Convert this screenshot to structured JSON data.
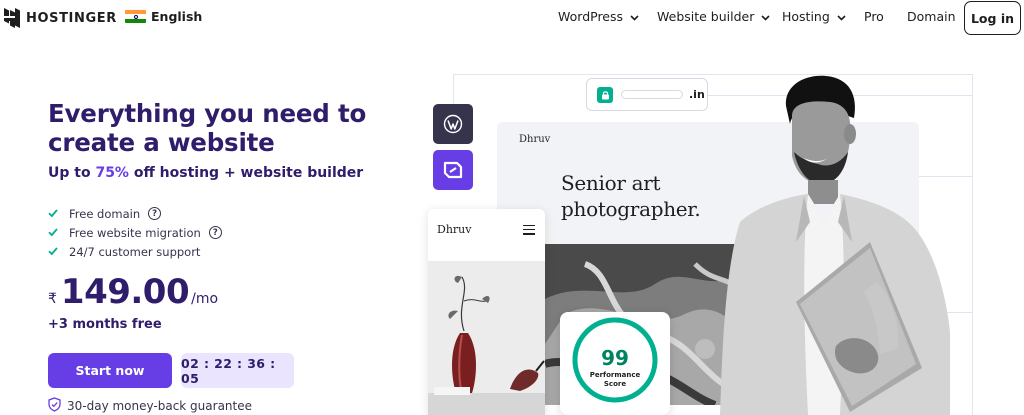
{
  "header": {
    "brand": "HOSTINGER",
    "language": "English",
    "nav": [
      {
        "label": "WordPress",
        "has_dropdown": true
      },
      {
        "label": "Website builder",
        "has_dropdown": true
      },
      {
        "label": "Hosting",
        "has_dropdown": true
      },
      {
        "label": "Pro",
        "has_dropdown": false
      },
      {
        "label": "Domain",
        "has_dropdown": false
      }
    ],
    "login_label": "Log in"
  },
  "hero": {
    "title": "Everything you need to create a website",
    "subtitle_prefix": "Up to ",
    "subtitle_discount": "75%",
    "subtitle_suffix": " off hosting + website builder",
    "features": [
      {
        "label": "Free domain",
        "has_help": true
      },
      {
        "label": "Free website migration",
        "has_help": true
      },
      {
        "label": "24/7 customer support",
        "has_help": false
      }
    ],
    "currency": "₹",
    "price": "149.00",
    "per": "/mo",
    "bonus": "+3 months free",
    "cta_label": "Start now",
    "countdown": "02 : 22 : 36 : 05",
    "guarantee": "30-day money-back guarantee"
  },
  "preview": {
    "url_tld": ".in",
    "desktop_site_name": "Dhruv",
    "desktop_headline_line1": "Senior art",
    "desktop_headline_line2": "photographer.",
    "mobile_site_name": "Dhruv",
    "performance_score": "99",
    "performance_score_value": 99,
    "performance_label_line1": "Performance",
    "performance_label_line2": "Score"
  },
  "colors": {
    "brand_purple": "#673de6",
    "heading_navy": "#2f1c6a",
    "timer_bg": "#ebe4ff",
    "check_green": "#00b090",
    "score_green": "#008361"
  },
  "icons": {
    "logo": "hostinger-logo-icon",
    "flag": "india-flag-icon",
    "dropdown": "chevron-down-icon",
    "feature_check": "check-icon",
    "feature_help": "question-circle-icon",
    "guarantee": "shield-check-icon",
    "url_lock": "lock-icon",
    "wordpress": "wordpress-icon",
    "builder": "website-builder-icon",
    "menu": "hamburger-icon"
  }
}
